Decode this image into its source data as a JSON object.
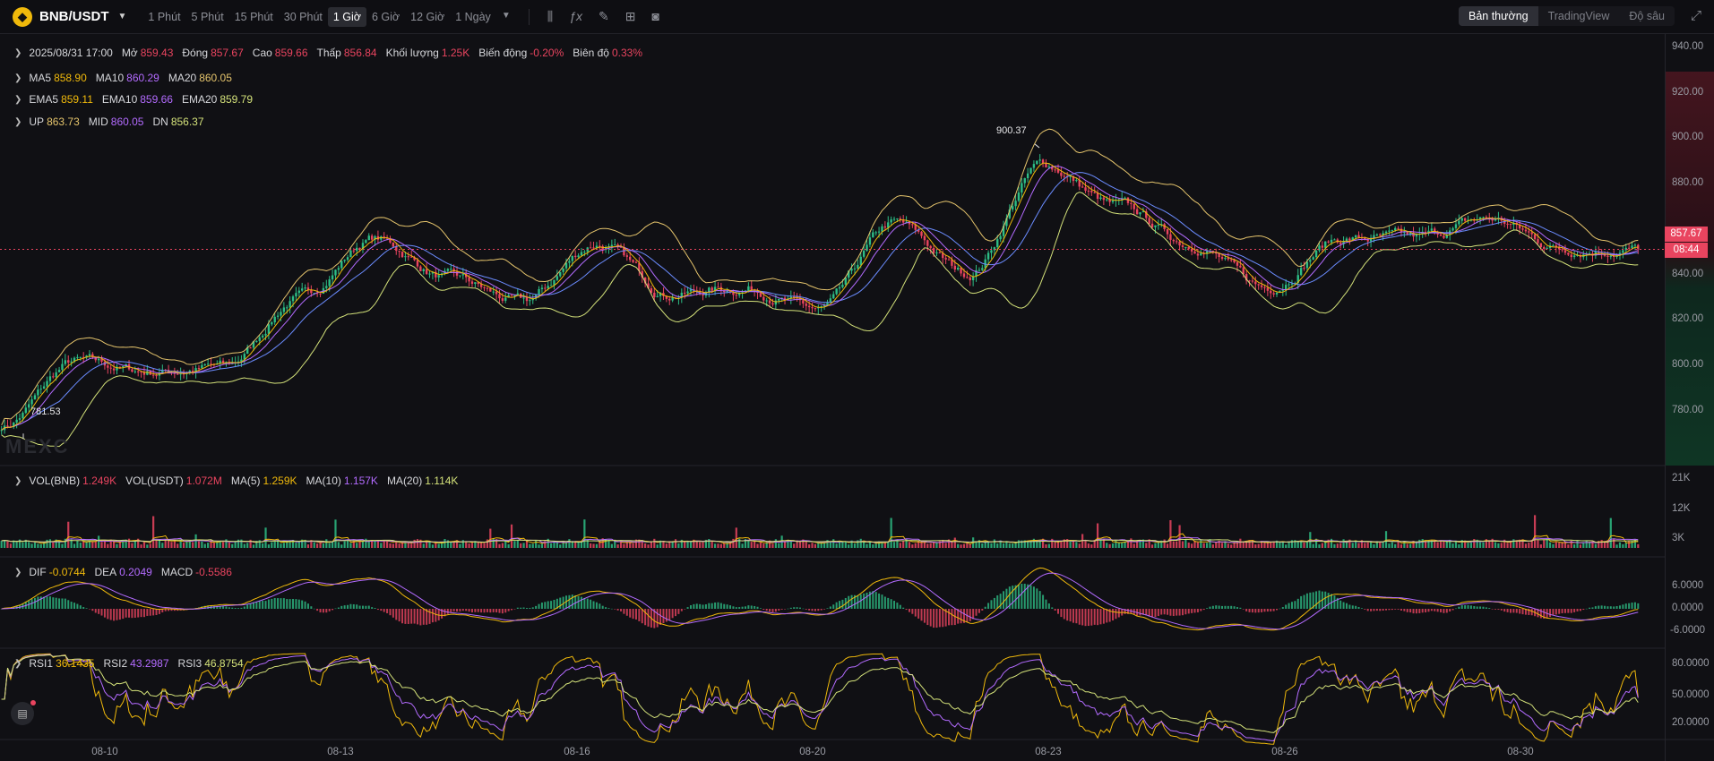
{
  "header": {
    "symbol": "BNB/USDT",
    "intervals": [
      "1 Phút",
      "5 Phút",
      "15 Phút",
      "30 Phút",
      "1 Giờ",
      "6 Giờ",
      "12 Giờ",
      "1 Ngày"
    ],
    "active_interval": "1 Giờ",
    "tool_icons": [
      "candle-type-icon",
      "indicator-icon",
      "draw-icon",
      "layout-icon",
      "camera-icon"
    ],
    "views": [
      "Bản thường",
      "TradingView",
      "Độ sâu"
    ],
    "active_view": "Bản thường"
  },
  "ohlc_legend": {
    "datetime": "2025/08/31 17:00",
    "open_label": "Mở",
    "open": "859.43",
    "close_label": "Đóng",
    "close": "857.67",
    "high_label": "Cao",
    "high": "859.66",
    "low_label": "Thấp",
    "low": "856.84",
    "volume_label": "Khối lượng",
    "volume": "1.25K",
    "change_label": "Biến động",
    "change": "-0.20%",
    "amplitude_label": "Biên độ",
    "amplitude": "0.33%"
  },
  "ma_legend": {
    "ma5_label": "MA5",
    "ma5": "858.90",
    "ma10_label": "MA10",
    "ma10": "860.29",
    "ma20_label": "MA20",
    "ma20": "860.05"
  },
  "ema_legend": {
    "ema5_label": "EMA5",
    "ema5": "859.11",
    "ema10_label": "EMA10",
    "ema10": "859.66",
    "ema20_label": "EMA20",
    "ema20": "859.79"
  },
  "boll_legend": {
    "up_label": "UP",
    "up": "863.73",
    "mid_label": "MID",
    "mid": "860.05",
    "dn_label": "DN",
    "dn": "856.37"
  },
  "vol_legend": {
    "vol_bnb_label": "VOL(BNB)",
    "vol_bnb": "1.249K",
    "vol_usdt_label": "VOL(USDT)",
    "vol_usdt": "1.072M",
    "ma5_label": "MA(5)",
    "ma5": "1.259K",
    "ma10_label": "MA(10)",
    "ma10": "1.157K",
    "ma20_label": "MA(20)",
    "ma20": "1.114K"
  },
  "macd_legend": {
    "dif_label": "DIF",
    "dif": "-0.0744",
    "dea_label": "DEA",
    "dea": "0.2049",
    "macd_label": "MACD",
    "macd": "-0.5586"
  },
  "rsi_legend": {
    "rsi1_label": "RSI1",
    "rsi1": "36.1435",
    "rsi2_label": "RSI2",
    "rsi2": "43.2987",
    "rsi3_label": "RSI3",
    "rsi3": "46.8754"
  },
  "price_axis": [
    "940.00",
    "920.00",
    "900.00",
    "880.00",
    "860.00",
    "840.00",
    "820.00",
    "800.00",
    "780.00"
  ],
  "vol_axis": [
    "21K",
    "12K",
    "3K"
  ],
  "macd_axis": [
    "6.0000",
    "0.0000",
    "-6.0000"
  ],
  "rsi_axis": [
    "80.0000",
    "50.0000",
    "20.0000"
  ],
  "x_axis": [
    "08-10",
    "08-13",
    "08-16",
    "08-20",
    "08-23",
    "08-26",
    "08-30"
  ],
  "last_price": "857.67",
  "countdown": "08:44",
  "high_marker": "900.37",
  "low_marker": "781.53",
  "watermark": "MEXC",
  "colors": {
    "up": "#2dbd85",
    "down": "#e9445f",
    "ma5": "#f0b90b",
    "ma10": "#b36bff",
    "ma20": "#6b8cff",
    "boll_up": "#e5c46c",
    "boll_dn": "#d4e27a"
  },
  "chart_data": {
    "type": "candlestick",
    "interval": "1 Giờ",
    "ylim": [
      770,
      945
    ],
    "x": [
      "08-10",
      "08-13",
      "08-16",
      "08-20",
      "08-23",
      "08-26",
      "08-30"
    ],
    "close_path": [
      {
        "x": "08-09",
        "y": 786
      },
      {
        "x": "08-10",
        "y": 812
      },
      {
        "x": "08-11",
        "y": 808
      },
      {
        "x": "08-12",
        "y": 810
      },
      {
        "x": "08-13",
        "y": 838
      },
      {
        "x": "08-14",
        "y": 862
      },
      {
        "x": "08-15",
        "y": 846
      },
      {
        "x": "08-16",
        "y": 836
      },
      {
        "x": "08-17",
        "y": 860
      },
      {
        "x": "08-18",
        "y": 840
      },
      {
        "x": "08-19",
        "y": 842
      },
      {
        "x": "08-20",
        "y": 833
      },
      {
        "x": "08-21",
        "y": 868
      },
      {
        "x": "08-22",
        "y": 848
      },
      {
        "x": "08-23",
        "y": 892
      },
      {
        "x": "08-24",
        "y": 875
      },
      {
        "x": "08-25",
        "y": 860
      },
      {
        "x": "08-26",
        "y": 842
      },
      {
        "x": "08-27",
        "y": 862
      },
      {
        "x": "08-28",
        "y": 862
      },
      {
        "x": "08-29",
        "y": 870
      },
      {
        "x": "08-30",
        "y": 858
      },
      {
        "x": "08-31",
        "y": 857.67
      }
    ],
    "high": 900.37,
    "low": 781.53
  }
}
